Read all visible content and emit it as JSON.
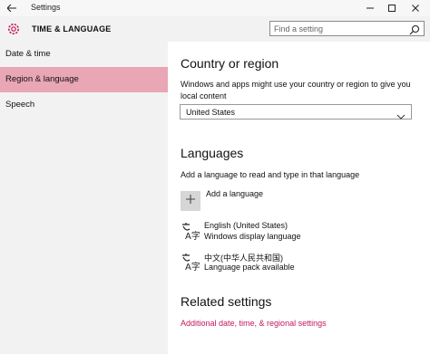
{
  "window": {
    "title": "Settings"
  },
  "header": {
    "title": "TIME & LANGUAGE",
    "search_placeholder": "Find a setting"
  },
  "sidebar": {
    "items": [
      {
        "label": "Date & time"
      },
      {
        "label": "Region & language",
        "selected": true
      },
      {
        "label": "Speech"
      }
    ]
  },
  "country": {
    "heading": "Country or region",
    "description": "Windows and apps might use your country or region to give you local content",
    "selected": "United States"
  },
  "languages": {
    "heading": "Languages",
    "description": "Add a language to read and type in that language",
    "add_label": "Add a language",
    "items": [
      {
        "name": "English (United States)",
        "status": "Windows display language"
      },
      {
        "name": "中文(中华人民共和国)",
        "status": "Language pack available"
      }
    ]
  },
  "related": {
    "heading": "Related settings",
    "link": "Additional date, time, & regional settings"
  },
  "colors": {
    "accent": "#e9a6b5",
    "link": "#c2185b",
    "sidebar_bg": "#f2f2f2"
  },
  "icons": {
    "back": "back-arrow-icon",
    "settings": "gear-icon",
    "search": "search-icon",
    "language": "language-icon",
    "add": "plus-icon"
  }
}
